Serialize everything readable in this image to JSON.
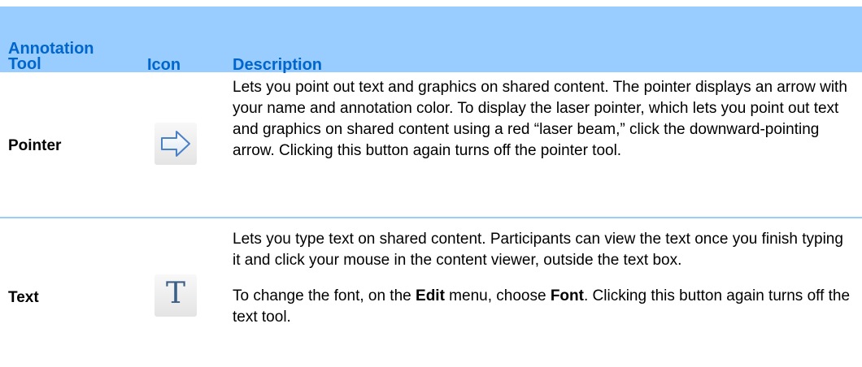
{
  "table": {
    "headers": {
      "tool": "Annotation Tool",
      "icon": "Icon",
      "description": "Description"
    },
    "rows": [
      {
        "tool": "Pointer",
        "icon": "pointer-arrow-icon",
        "description": [
          "Lets you point out text and graphics on shared content. The pointer displays an arrow with your name and annotation color. To display the laser pointer, which lets you point out text and graphics on shared content using a red “laser beam,” click the downward-pointing arrow. Clicking this button again turns off the pointer tool."
        ]
      },
      {
        "tool": "Text",
        "icon": "text-tool-icon",
        "icon_glyph": "T",
        "description": [
          "Lets you type text on shared content. Participants can view the text once you finish typing it and click your mouse in the content viewer, outside the text box.",
          {
            "before_edit": "To change the font, on the ",
            "edit": "Edit",
            "before_font": " menu, choose ",
            "font": "Font",
            "after": ". Clicking this button again turns off the text tool."
          }
        ]
      }
    ]
  },
  "colors": {
    "header_background": "#99ccff",
    "header_text": "#0066cc",
    "icon_accent": "#4a80c8"
  }
}
